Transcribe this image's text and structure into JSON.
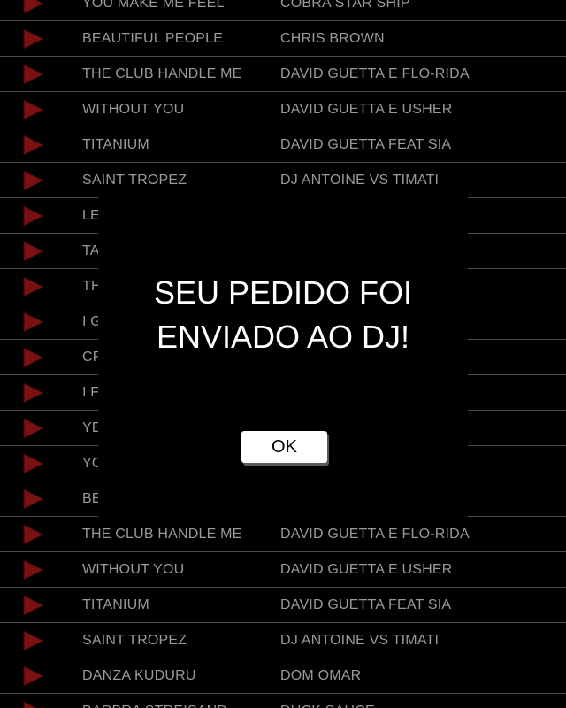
{
  "songs": [
    {
      "title": "YOU MAKE ME FEEL",
      "artist": "COBRA STAR SHIP"
    },
    {
      "title": "BEAUTIFUL PEOPLE",
      "artist": "CHRIS BROWN"
    },
    {
      "title": "THE CLUB HANDLE ME",
      "artist": "DAVID GUETTA E FLO-RIDA"
    },
    {
      "title": "WITHOUT YOU",
      "artist": "DAVID GUETTA E USHER"
    },
    {
      "title": "TITANIUM",
      "artist": "DAVID GUETTA FEAT SIA"
    },
    {
      "title": "SAINT TROPEZ",
      "artist": "DJ ANTOINE VS TIMATI"
    },
    {
      "title": "LE",
      "artist": ""
    },
    {
      "title": "TA",
      "artist": ""
    },
    {
      "title": "TH",
      "artist": ""
    },
    {
      "title": "I G",
      "artist": ""
    },
    {
      "title": "CR",
      "artist": ""
    },
    {
      "title": "I F",
      "artist": ""
    },
    {
      "title": "YE",
      "artist": ""
    },
    {
      "title": "YC",
      "artist": ""
    },
    {
      "title": "BE",
      "artist": ""
    },
    {
      "title": "THE CLUB HANDLE ME",
      "artist": "DAVID GUETTA E FLO-RIDA"
    },
    {
      "title": "WITHOUT YOU",
      "artist": "DAVID GUETTA E USHER"
    },
    {
      "title": "TITANIUM",
      "artist": "DAVID GUETTA FEAT SIA"
    },
    {
      "title": "SAINT TROPEZ",
      "artist": "DJ ANTOINE VS TIMATI"
    },
    {
      "title": "DANZA KUDURU",
      "artist": "DOM OMAR"
    },
    {
      "title": "BARBRA STREISAND",
      "artist": "DUCK SAUCE"
    }
  ],
  "dialog": {
    "message": "SEU PEDIDO FOI\nENVIADO AO DJ!",
    "ok_label": "OK"
  },
  "icons": {
    "row_action": "play-icon"
  },
  "colors": {
    "play_icon": "#7a1010",
    "row_text": "#9a9a9a",
    "divider": "#4a4a4a"
  }
}
